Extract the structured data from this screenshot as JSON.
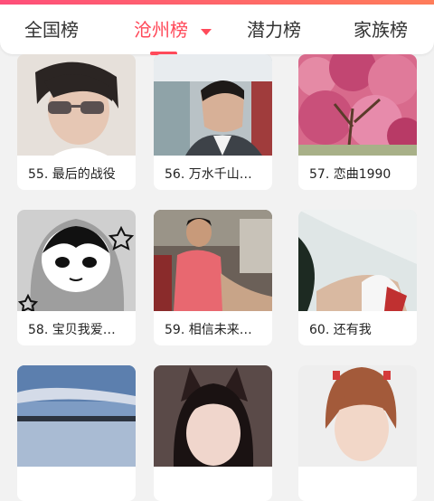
{
  "tabs": [
    {
      "label": "全国榜"
    },
    {
      "label": "沧州榜"
    },
    {
      "label": "潜力榜"
    },
    {
      "label": "家族榜"
    }
  ],
  "cards": [
    {
      "caption": "55. 最后的战役"
    },
    {
      "caption": "56. 万水千山…"
    },
    {
      "caption": "57. 恋曲1990"
    },
    {
      "caption": "58. 宝贝我爱…"
    },
    {
      "caption": "59. 相信未来…"
    },
    {
      "caption": "60. 还有我"
    },
    {
      "caption": ""
    },
    {
      "caption": ""
    },
    {
      "caption": ""
    }
  ],
  "colors": {
    "accent": "#ff4a5a"
  }
}
